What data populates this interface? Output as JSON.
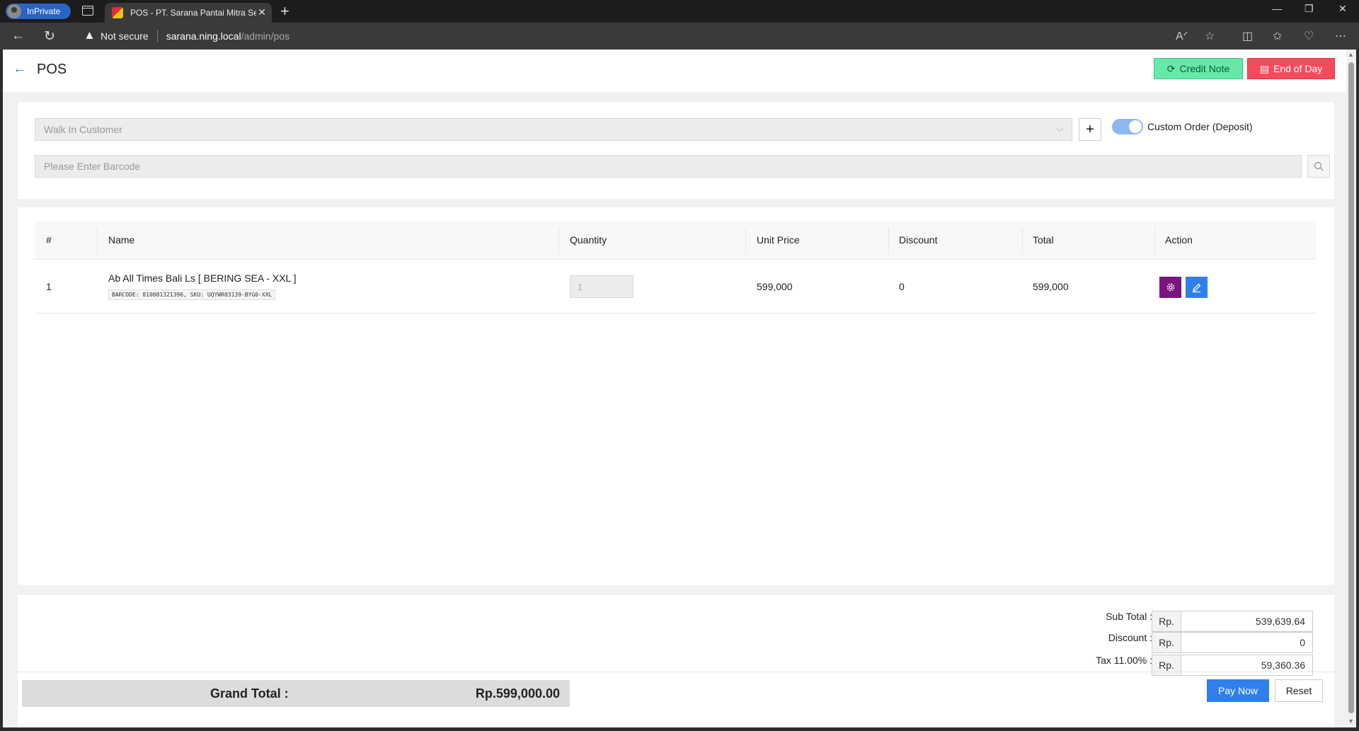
{
  "browser": {
    "inprivate_label": "InPrivate",
    "tab_title": "POS - PT. Sarana Pantai Mitra Se",
    "security_label": "Not secure",
    "url_host": "sarana.ning.local",
    "url_path": "/admin/pos"
  },
  "header": {
    "title": "POS",
    "credit_note_label": "Credit Note",
    "end_of_day_label": "End of Day"
  },
  "customer": {
    "placeholder": "Walk In Customer",
    "custom_order_label": "Custom Order (Deposit)",
    "custom_order_enabled": true
  },
  "barcode": {
    "placeholder": "Please Enter Barcode"
  },
  "table": {
    "columns": [
      "#",
      "Name",
      "Quantity",
      "Unit Price",
      "Discount",
      "Total",
      "Action"
    ],
    "rows": [
      {
        "index": "1",
        "name": "Ab All Times Bali Ls [ BERING SEA - XXL ]",
        "meta": "BARCODE: 810081321396, SKU: UQYWR03139-BYG0-XXL",
        "quantity": "1",
        "unit_price": "599,000",
        "discount": "0",
        "total": "599,000"
      }
    ]
  },
  "summary": {
    "currency": "Rp.",
    "sub_total_label": "Sub Total :",
    "sub_total": "539,639.64",
    "discount_label": "Discount :",
    "discount": "0",
    "tax_label": "Tax 11.00% :",
    "tax": "59,360.36",
    "grand_total_label": "Grand Total :",
    "grand_total": "Rp.599,000.00",
    "pay_now_label": "Pay Now",
    "reset_label": "Reset"
  },
  "colors": {
    "accent_blue": "#2f80ed",
    "credit_note_green": "#67e8a9",
    "end_of_day_red": "#f44c5c",
    "gear_purple": "#7b157e"
  },
  "icons": {
    "back": "back-arrow-icon",
    "refresh": "refresh-icon",
    "credit_note": "sync-icon",
    "end_of_day": "receipt-icon",
    "add_customer": "plus-icon",
    "search": "search-icon",
    "settings": "gear-icon",
    "edit": "pencil-icon"
  }
}
